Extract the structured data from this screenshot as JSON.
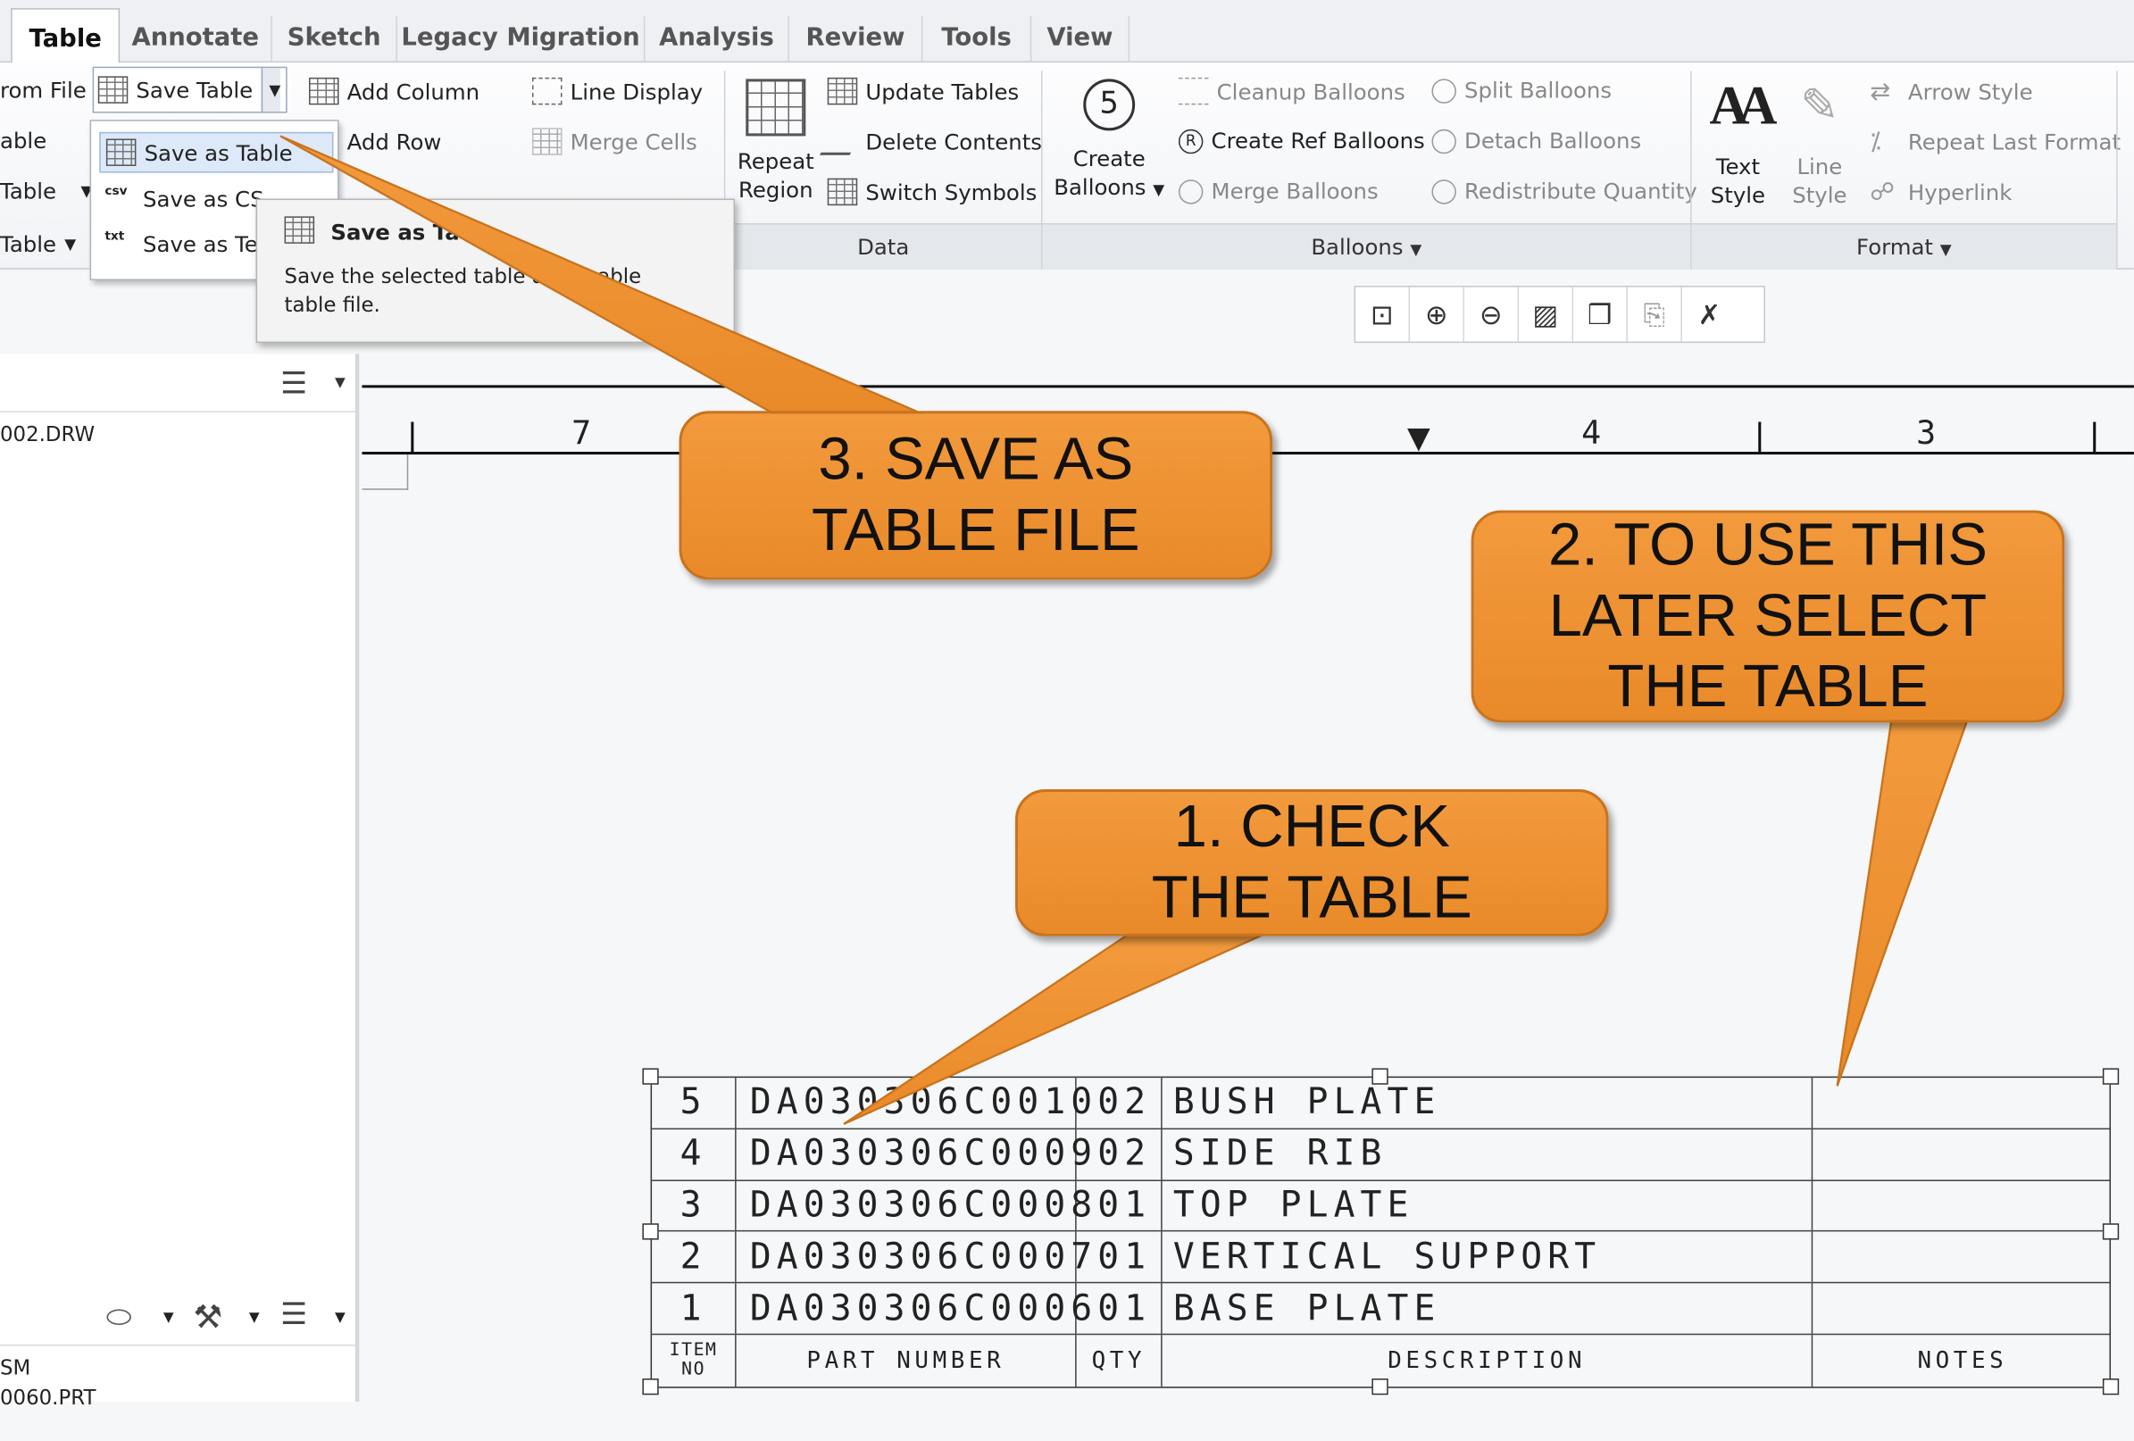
{
  "tabs": [
    "Table",
    "Annotate",
    "Sketch",
    "Legacy Migration",
    "Analysis",
    "Review",
    "Tools",
    "View"
  ],
  "ribbon": {
    "from_file": "rom File",
    "table_partial": "able",
    "table_dd": "Table",
    "table_dd2": "Table",
    "save_table": "Save Table",
    "add_column": "Add Column",
    "add_row": "Add Row",
    "line_display": "Line Display",
    "merge_cells": "Merge Cells",
    "repeat_region": [
      "Repeat",
      "Region"
    ],
    "update_tables": "Update Tables",
    "delete_contents": "Delete Contents",
    "switch_symbols": "Switch Symbols",
    "create_balloons": [
      "Create",
      "Balloons"
    ],
    "cleanup_balloons": "Cleanup Balloons",
    "create_ref_balloons": "Create Ref Balloons",
    "merge_balloons": "Merge Balloons",
    "split_balloons": "Split Balloons",
    "detach_balloons": "Detach Balloons",
    "redistribute_quantity": "Redistribute Quantity",
    "text_style": [
      "Text",
      "Style"
    ],
    "line_style": [
      "Line",
      "Style"
    ],
    "arrow_style": "Arrow Style",
    "repeat_last_format": "Repeat Last Format",
    "hyperlink": "Hyperlink",
    "groups": {
      "data": "Data",
      "balloons": "Balloons",
      "format": "Format"
    }
  },
  "menu": {
    "items": [
      "Save as Table",
      "Save as CS",
      "Save as Te"
    ]
  },
  "tooltip": {
    "title": "Save as Ta",
    "body": "Save the selected table a      trievable table file."
  },
  "left_panel": {
    "file1": "002.DRW",
    "asm": "SM",
    "prt": "0060.PRT"
  },
  "ruler": [
    "7",
    "4",
    "3"
  ],
  "callouts": {
    "c1": "1. CHECK THE TABLE",
    "c2": "2. TO USE THIS LATER SELECT THE TABLE",
    "c3": "3. SAVE AS TABLE FILE"
  },
  "bom": {
    "rows": [
      {
        "item": "5",
        "part": "DA030306C001002",
        "desc": "BUSH PLATE"
      },
      {
        "item": "4",
        "part": "DA030306C000902",
        "desc": "SIDE RIB"
      },
      {
        "item": "3",
        "part": "DA030306C000801",
        "desc": "TOP PLATE"
      },
      {
        "item": "2",
        "part": "DA030306C000701",
        "desc": "VERTICAL SUPPORT"
      },
      {
        "item": "1",
        "part": "DA030306C000601",
        "desc": "BASE PLATE"
      }
    ],
    "headers": {
      "item": "ITEM NO",
      "part": "PART NUMBER",
      "qty": "QTY",
      "desc": "DESCRIPTION",
      "notes": "NOTES"
    }
  },
  "colors": {
    "callout": "#ee922f",
    "ribbon_bg": "#f1f3f6"
  }
}
